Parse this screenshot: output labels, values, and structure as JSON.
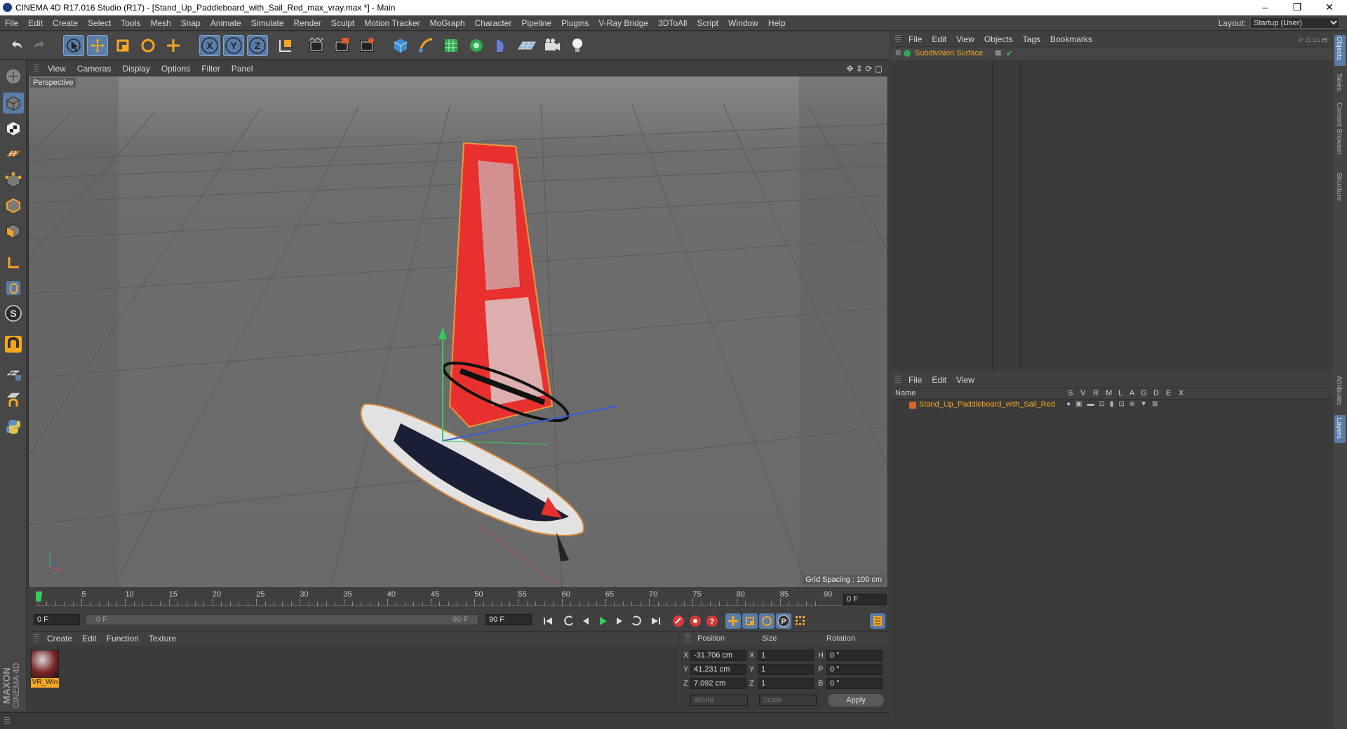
{
  "window": {
    "title": "CINEMA 4D R17.016 Studio (R17) - [Stand_Up_Paddleboard_with_Sail_Red_max_vray.max *] - Main",
    "minimize": "–",
    "maximize": "❐",
    "close": "✕"
  },
  "menubar": {
    "items": [
      "File",
      "Edit",
      "Create",
      "Select",
      "Tools",
      "Mesh",
      "Snap",
      "Animate",
      "Simulate",
      "Render",
      "Sculpt",
      "Motion Tracker",
      "MoGraph",
      "Character",
      "Pipeline",
      "Plugins",
      "V-Ray Bridge",
      "3DToAll",
      "Script",
      "Window",
      "Help"
    ],
    "layout_label": "Layout:",
    "layout_value": "Startup (User)"
  },
  "toolbar": {
    "icons": [
      "undo-icon",
      "redo-icon",
      "select-icon",
      "move-icon",
      "scale-icon",
      "rotate-icon",
      "transform-icon",
      "x-axis-icon",
      "y-axis-icon",
      "z-axis-icon",
      "world-coordinates-icon",
      "render-view-icon",
      "render-picture-viewer-icon",
      "render-settings-icon",
      "cube-icon",
      "pen-icon",
      "subdivision-icon",
      "array-icon",
      "deformer-icon",
      "floor-icon",
      "camera-icon",
      "light-icon"
    ],
    "axis_labels": [
      "X",
      "Y",
      "Z"
    ]
  },
  "lefttools": {
    "icons": [
      "make-editable-icon",
      "model-mode-icon",
      "texture-mode-icon",
      "workplane-icon",
      "points-mode-icon",
      "edges-mode-icon",
      "polygons-mode-icon",
      "axis-mode-icon",
      "tweak-mode-icon",
      "solo-mode-icon",
      "snap-icon",
      "grid-lock-icon",
      "grid-snap-icon",
      "python-icon"
    ],
    "snap_label": "S"
  },
  "viewport": {
    "menu": [
      "View",
      "Cameras",
      "Display",
      "Options",
      "Filter",
      "Panel"
    ],
    "camera_label": "Perspective",
    "grid_spacing": "Grid Spacing : 100 cm",
    "colors": {
      "background": "#6e6e6e",
      "sail": "#e8302e",
      "board_dark": "#1a1f35",
      "selection": "#e69a3c"
    }
  },
  "timeline": {
    "ticks": [
      "0",
      "5",
      "10",
      "15",
      "20",
      "25",
      "30",
      "35",
      "40",
      "45",
      "50",
      "55",
      "60",
      "65",
      "70",
      "75",
      "80",
      "85",
      "90"
    ],
    "current_frame": "0 F",
    "start_frame": "0 F",
    "range_start": "0 F",
    "range_end": "90 F",
    "end_frame": "90 F"
  },
  "material_manager": {
    "menu": [
      "Create",
      "Edit",
      "Function",
      "Texture"
    ],
    "materials": [
      {
        "name": "VR_Win"
      }
    ],
    "brand_top": "MAXON",
    "brand_bottom": "CINEMA 4D"
  },
  "coordinates": {
    "headers": [
      "Position",
      "Size",
      "Rotation"
    ],
    "rows": [
      {
        "axis": "X",
        "position": "-31.706 cm",
        "size_axis": "X",
        "size": "1",
        "rot_axis": "H",
        "rotation": "0 °"
      },
      {
        "axis": "Y",
        "position": "41.231 cm",
        "size_axis": "Y",
        "size": "1",
        "rot_axis": "P",
        "rotation": "0 °"
      },
      {
        "axis": "Z",
        "position": "7.092 cm",
        "size_axis": "Z",
        "size": "1",
        "rot_axis": "B",
        "rotation": "0 °"
      }
    ],
    "mode": "World",
    "scale_mode": "Scale",
    "apply": "Apply"
  },
  "objects_panel": {
    "menu": [
      "File",
      "Edit",
      "View",
      "Objects",
      "Tags",
      "Bookmarks"
    ],
    "items": [
      {
        "name": "Subdivision Surface"
      }
    ]
  },
  "layers_panel": {
    "menu": [
      "File",
      "Edit",
      "View"
    ],
    "columns": [
      "Name",
      "S",
      "V",
      "R",
      "M",
      "L",
      "A",
      "G",
      "D",
      "E",
      "X"
    ],
    "items": [
      {
        "name": "Stand_Up_Paddleboard_with_Sail_Red",
        "color": "#d6682a"
      }
    ]
  },
  "side_tabs": [
    "Objects",
    "Takes",
    "Content Browser",
    "Structure",
    "Attributes",
    "Layers"
  ]
}
